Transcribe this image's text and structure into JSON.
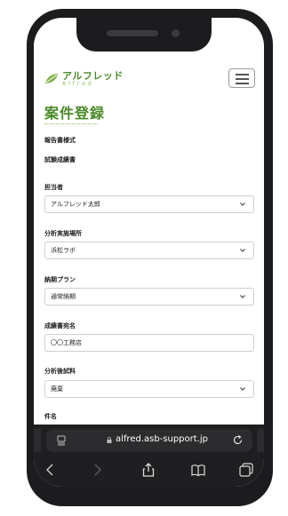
{
  "header": {
    "logo_text": "アルフレッド",
    "logo_sub": "Alfred"
  },
  "page_title": "案件登録",
  "sections": {
    "report_format_label": "報告書様式",
    "test_report_label": "試験成績書"
  },
  "form": {
    "person_label": "担当者",
    "person_value": "アルフレッド太郎",
    "location_label": "分析実施場所",
    "location_value": "浜松ラボ",
    "delivery_label": "納期プラン",
    "delivery_value": "通常納期",
    "addressee_label": "成績書宛名",
    "addressee_value": "〇〇工務店",
    "sample_label": "分析後試料",
    "sample_value": "廃棄",
    "subject_label": "件名"
  },
  "browser": {
    "url": "alfred.asb-support.jp"
  },
  "icons": [
    "leaf-logo-icon",
    "hamburger-menu-icon",
    "chevron-down-icon",
    "tabs-icon",
    "lock-icon",
    "reload-icon",
    "back-icon",
    "forward-icon",
    "share-icon",
    "bookmarks-icon",
    "tab-overview-icon"
  ]
}
